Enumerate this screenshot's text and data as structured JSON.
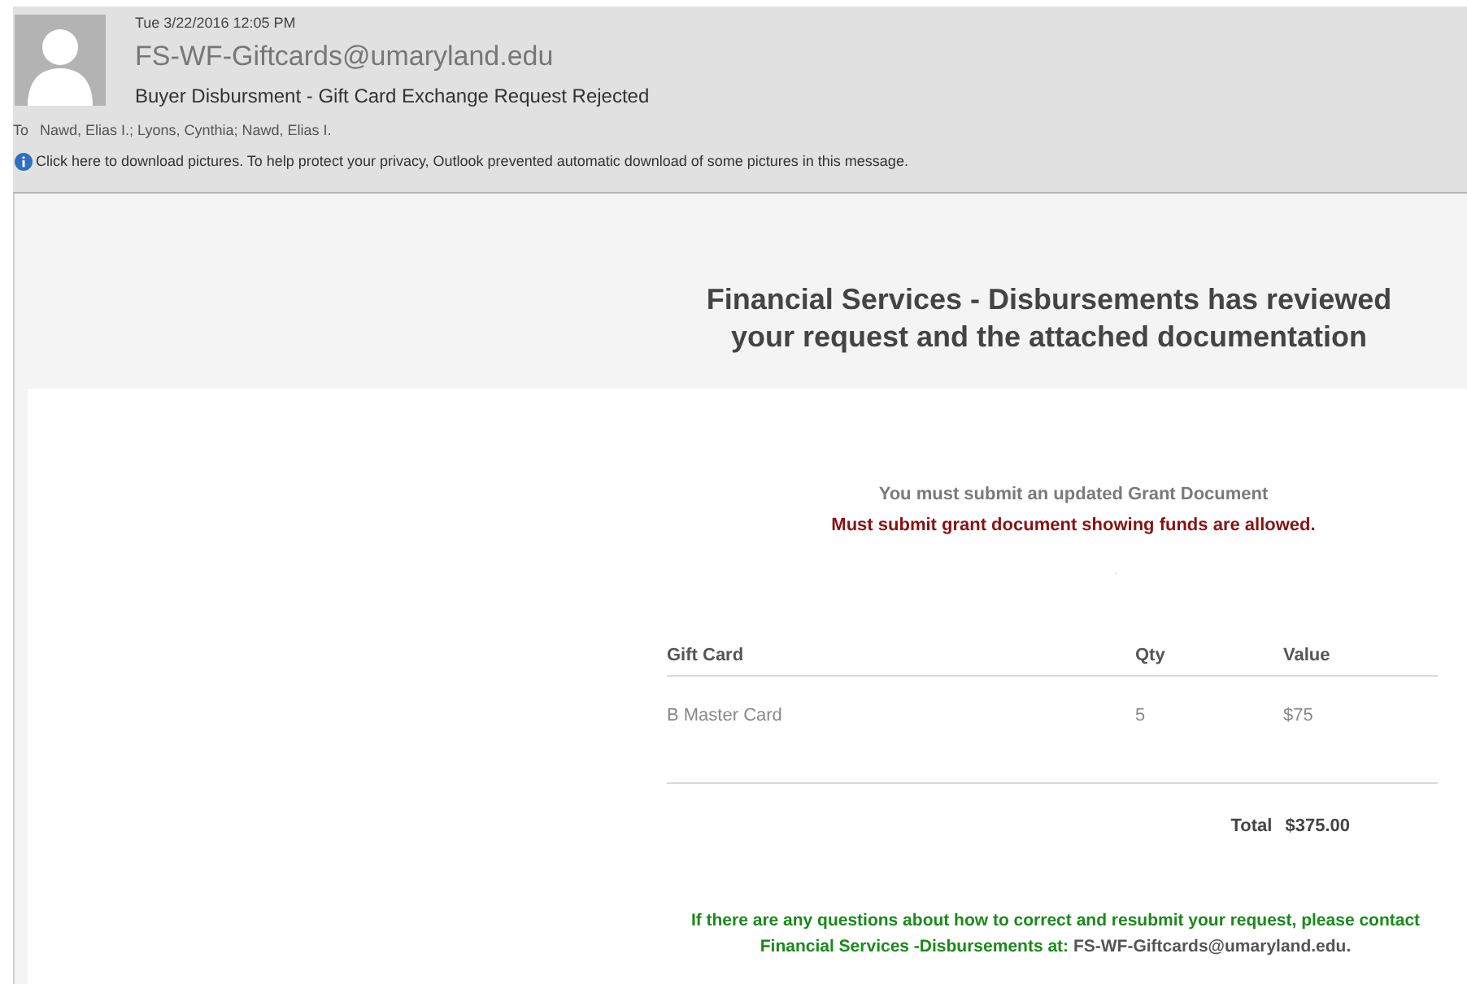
{
  "header": {
    "date": "Tue 3/22/2016 12:05 PM",
    "sender": "FS-WF-Giftcards@umaryland.edu",
    "subject": "Buyer Disbursment - Gift Card Exchange Request Rejected",
    "to_label": "To",
    "recipients": "Nawd, Elias I.; Lyons, Cynthia; Nawd, Elias I.",
    "info": "Click here to download pictures. To help protect your privacy, Outlook prevented automatic download of some pictures in this message."
  },
  "body": {
    "heading": "Financial Services - Disbursements has reviewed your request and the attached documentation",
    "notice": "You must submit an updated Grant Document",
    "reason": "Must submit grant document showing funds are allowed.",
    "dot": ".",
    "table": {
      "columns": [
        "Gift Card",
        "Qty",
        "Value"
      ],
      "rows": [
        [
          "B Master Card",
          "5",
          "$75"
        ]
      ]
    },
    "total_label": "Total",
    "total": "$375.00",
    "contact_text": "If there are any questions about how to correct and resubmit your request, please contact Financial Services -Disbursements at:",
    "contact_email": "FS-WF-Giftcards@umaryland.edu."
  }
}
